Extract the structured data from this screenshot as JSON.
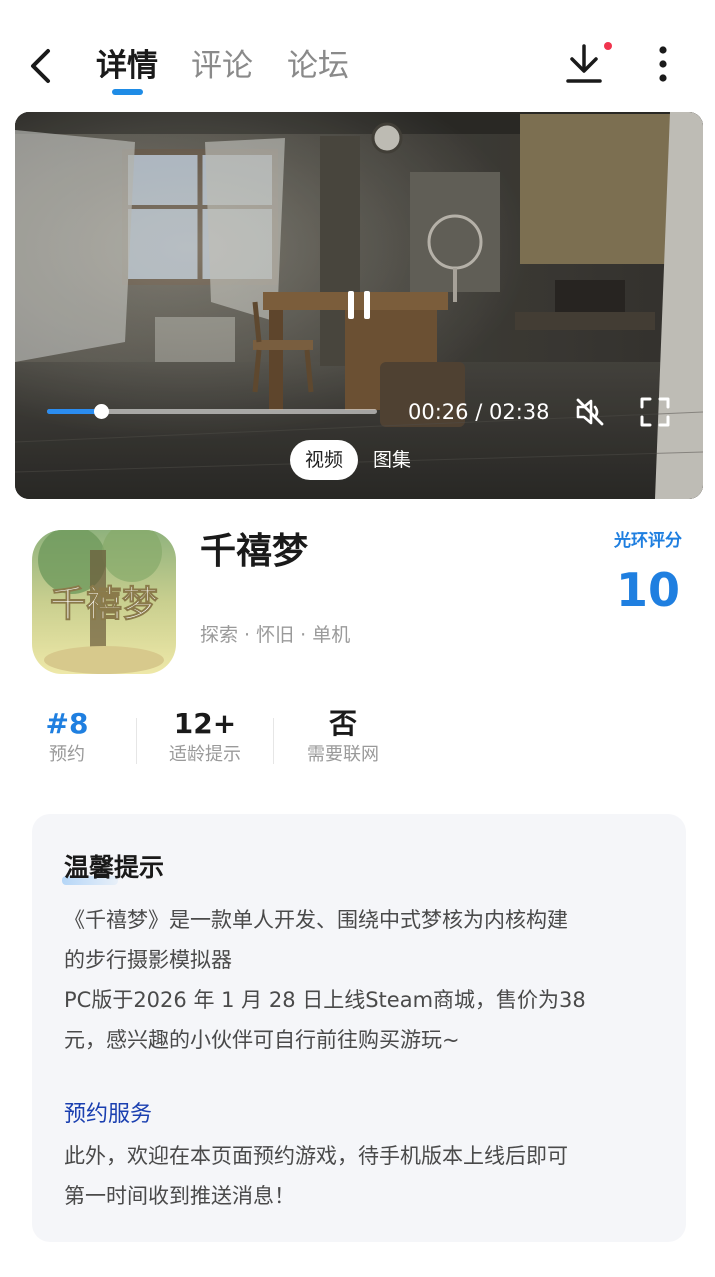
{
  "header": {
    "tabs": [
      {
        "label": "详情",
        "active": true
      },
      {
        "label": "评论",
        "active": false
      },
      {
        "label": "论坛",
        "active": false
      }
    ],
    "back_icon": "chevron-left-icon",
    "download_icon": "download-icon",
    "more_icon": "more-vertical-icon",
    "notification_dot_color": "#f0344e"
  },
  "video": {
    "state_icon": "pause-icon",
    "progress": 0.165,
    "current_time": "00:26",
    "total_time": "02:38",
    "time_separator": " / ",
    "mute_icon": "volume-muted-icon",
    "fullscreen_icon": "fullscreen-icon",
    "media_tabs": [
      {
        "label": "视频",
        "active": true
      },
      {
        "label": "图集",
        "active": false
      }
    ]
  },
  "app": {
    "icon_text": "千禧梦",
    "title": "千禧梦",
    "tags": "探索 · 怀旧 · 单机",
    "score_label": "光环评分",
    "score_value": "10"
  },
  "stats": [
    {
      "value": "#8",
      "label": "预约"
    },
    {
      "value": "12+",
      "label": "适龄提示"
    },
    {
      "value": "否",
      "label": "需要联网"
    }
  ],
  "notice": {
    "title": "温馨提示",
    "paragraph1_line1": "《千禧梦》是一款单人开发、围绕中式梦核为内核构建",
    "paragraph1_line2": "的步行摄影模拟器",
    "paragraph2_line1": "PC版于2026 年 1 月 28 日上线Steam商城，售价为38",
    "paragraph2_line2": "元，感兴趣的小伙伴可自行前往购买游玩~",
    "section_title": "预约服务",
    "paragraph3_line1": "此外，欢迎在本页面预约游戏，待手机版本上线后即可",
    "paragraph3_line2": "第一时间收到推送消息！"
  },
  "colors": {
    "accent": "#1f7fe0",
    "tab_indicator": "#1f8ce6",
    "progress": "#2b8df0",
    "section_title": "#1a3fb0"
  }
}
